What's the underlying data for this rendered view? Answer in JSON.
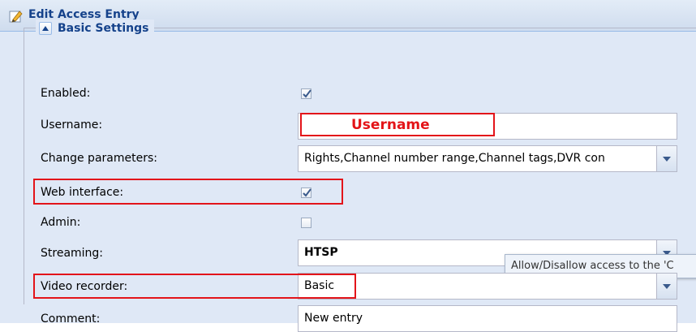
{
  "window": {
    "title": "Edit Access Entry",
    "title_icon": "edit-pencil-icon"
  },
  "section": {
    "legend": "Basic Settings",
    "collapse_icon": "collapse-up-icon"
  },
  "fields": {
    "enabled": {
      "label": "Enabled:",
      "checked": true
    },
    "username": {
      "label": "Username:",
      "value": "Username"
    },
    "change_parameters": {
      "label": "Change parameters:",
      "value": "Rights,Channel number range,Channel tags,DVR con"
    },
    "web_interface": {
      "label": "Web interface:",
      "checked": true
    },
    "admin": {
      "label": "Admin:",
      "checked": false
    },
    "streaming": {
      "label": "Streaming:",
      "value": "HTSP"
    },
    "video_recorder": {
      "label": "Video recorder:",
      "value": "Basic"
    },
    "comment": {
      "label": "Comment:",
      "value": "New entry"
    }
  },
  "tooltip": {
    "text": "Allow/Disallow access to the 'C"
  },
  "colors": {
    "highlight": "#e3141a",
    "title_text": "#15428b",
    "panel_bg": "#dfe8f6"
  }
}
